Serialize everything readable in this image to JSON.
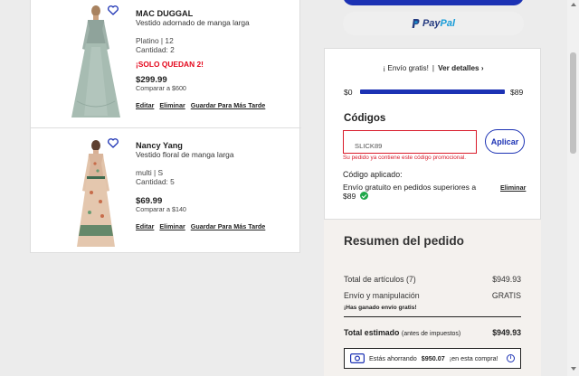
{
  "cart": {
    "items": [
      {
        "brand": "MAC DUGGAL",
        "description": "Vestido adornado de manga larga",
        "variant": "Platino | 12",
        "quantity": "Cantidad: 2",
        "alert": "¡SOLO QUEDAN 2!",
        "price": "$299.99",
        "compare": "Comparar a $600",
        "actions": [
          "Editar",
          "Eliminar",
          "Guardar Para Más Tarde"
        ]
      },
      {
        "brand": "Nancy Yang",
        "description": "Vestido floral de manga larga",
        "variant": "multi | S",
        "quantity": "Cantidad: 5",
        "price": "$69.99",
        "compare": "Comparar a $140",
        "actions": [
          "Editar",
          "Eliminar",
          "Guardar Para Más Tarde"
        ]
      }
    ]
  },
  "checkout": {
    "paypal_label_1": "Pay",
    "paypal_label_2": "Pal"
  },
  "shipping": {
    "title": "¡ Envío gratis!",
    "details_link": "Ver detalles ›",
    "bar_min": "$0",
    "bar_max": "$89",
    "progress": 1.0
  },
  "codes": {
    "title": "Códigos",
    "input_value": "SLICK89",
    "apply_label": "Aplicar",
    "error": "Su pedido ya contiene este código promocional.",
    "applied_title": "Código aplicado:",
    "applied_desc": "Envío gratuito en pedidos superiores a $89",
    "remove_label": "Eliminar"
  },
  "summary": {
    "title": "Resumen del pedido",
    "items_label": "Total de artículos (7)",
    "items_value": "$949.93",
    "shipping_label": "Envío y manipulación",
    "shipping_value": "GRATIS",
    "free_msg": "¡Has ganado envío gratis!",
    "total_label": "Total estimado",
    "total_note": "(antes de impuestos)",
    "total_value": "$949.93",
    "savings_prefix": "Estás ahorrando",
    "savings_amount": "$950.07",
    "savings_suffix": "¡en esta compra!"
  },
  "colors": {
    "accent": "#1c32b4",
    "error": "#d91a2a",
    "alert": "#e4061b",
    "success": "#1fa84a"
  }
}
